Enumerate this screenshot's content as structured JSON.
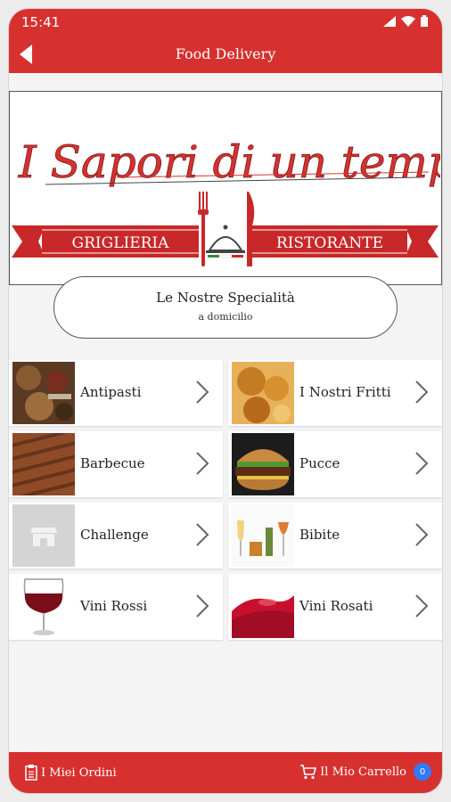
{
  "status_bar": {
    "time": "15:41"
  },
  "header": {
    "title": "Food Delivery"
  },
  "logo": {
    "script_text": "I Sapori di un tempo",
    "left_banner": "GRIGLIERIA",
    "right_banner": "RISTORANTE"
  },
  "specialties": {
    "title": "Le Nostre Specialità",
    "subtitle": "a domicilio"
  },
  "categories": [
    {
      "label": "Antipasti",
      "icon": "antipasti-photo"
    },
    {
      "label": "I Nostri Fritti",
      "icon": "fritti-photo"
    },
    {
      "label": "Barbecue",
      "icon": "barbecue-photo"
    },
    {
      "label": "Pucce",
      "icon": "pucce-photo"
    },
    {
      "label": "Challenge",
      "icon": "store-icon"
    },
    {
      "label": "Bibite",
      "icon": "bibite-photo"
    },
    {
      "label": "Vini Rossi",
      "icon": "red-wine-photo"
    },
    {
      "label": "Vini Rosati",
      "icon": "rose-wine-photo"
    }
  ],
  "bottom_bar": {
    "orders_label": "I Miei Ordini",
    "cart_label": "Il Mio Carrello",
    "cart_count": "0"
  },
  "colors": {
    "brand_red": "#d6312f",
    "badge_blue": "#3478f6"
  }
}
